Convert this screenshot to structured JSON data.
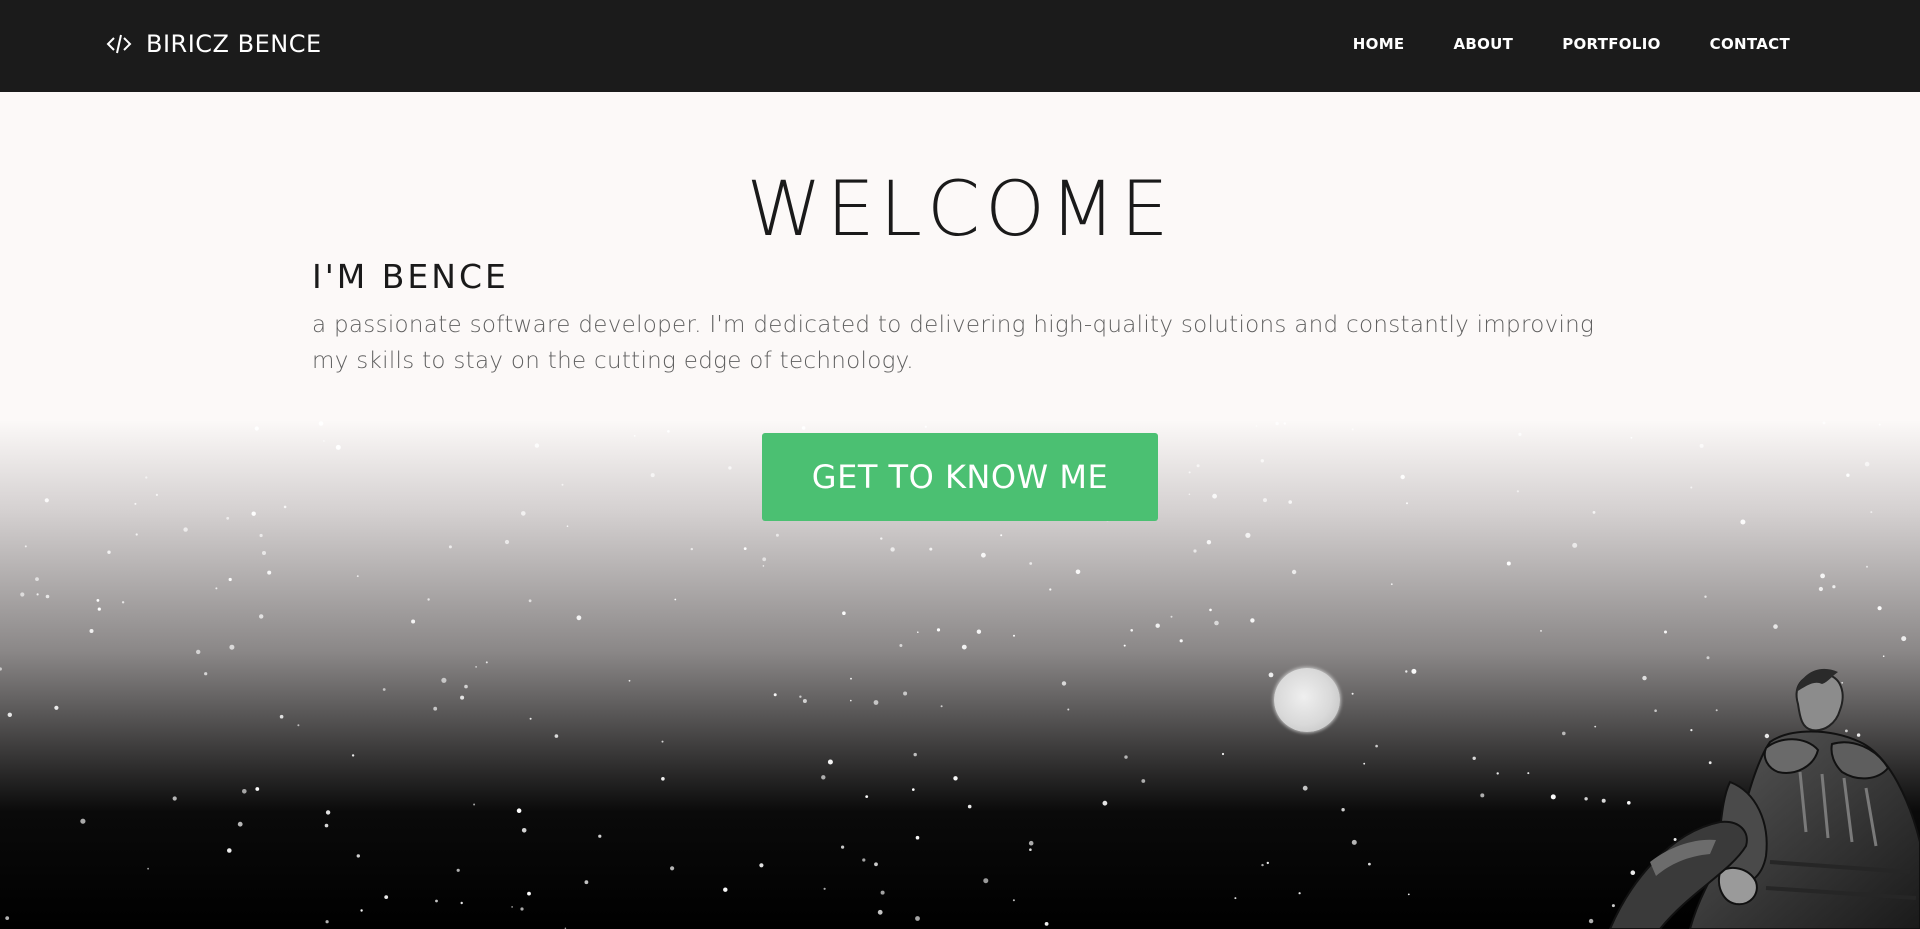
{
  "brand": {
    "icon": "code-icon",
    "name": "BIRICZ BENCE"
  },
  "nav": {
    "items": [
      {
        "label": "HOME"
      },
      {
        "label": "ABOUT"
      },
      {
        "label": "PORTFOLIO"
      },
      {
        "label": "CONTACT"
      }
    ]
  },
  "hero": {
    "welcome": "WELCOME",
    "title": "I'M BENCE",
    "intro": "a passionate software developer. I'm dedicated to delivering high-quality solutions and constantly improving my skills to stay on the cutting edge of technology.",
    "cta_label": "GET TO KNOW ME"
  },
  "colors": {
    "navbar_bg": "#1b1b1b",
    "page_bg": "#fcf9f8",
    "accent_green": "#4bc072",
    "text_dark": "#1a1a1a",
    "text_muted": "#606060"
  }
}
